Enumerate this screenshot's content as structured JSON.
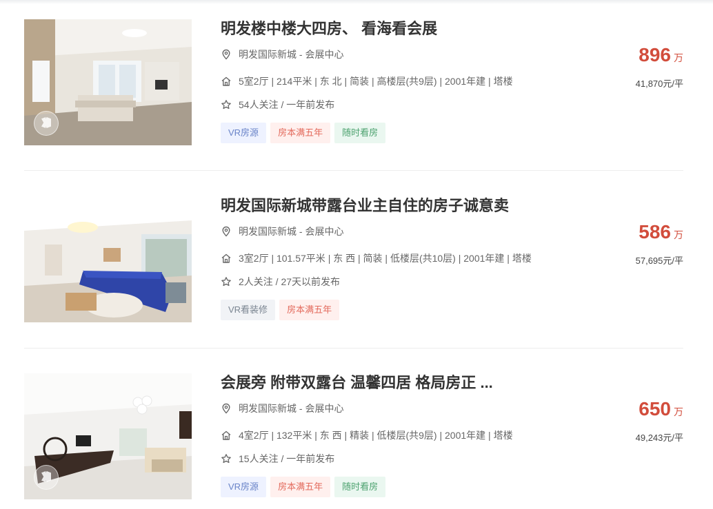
{
  "listings": [
    {
      "title": "明发楼中楼大四房、 看海看会展",
      "address": "明发国际新城 - 会展中心",
      "specs": "5室2厅 | 214平米 | 东 北 | 简装 | 高楼层(共9层) | 2001年建 | 塔楼",
      "follow": "54人关注 / 一年前发布",
      "tags": [
        "VR房源",
        "房本满五年",
        "随时看房"
      ],
      "price": "896",
      "price_unit": "万",
      "unit_price": "41,870元/平"
    },
    {
      "title": "明发国际新城带露台业主自住的房子诚意卖",
      "address": "明发国际新城 - 会展中心",
      "specs": "3室2厅 | 101.57平米 | 东 西 | 简装 | 低楼层(共10层) | 2001年建 | 塔楼",
      "follow": "2人关注 / 27天以前发布",
      "tags": [
        "VR看装修",
        "房本满五年"
      ],
      "price": "586",
      "price_unit": "万",
      "unit_price": "57,695元/平"
    },
    {
      "title": "会展旁 附带双露台 温馨四居 格局房正 ...",
      "address": "明发国际新城 - 会展中心",
      "specs": "4室2厅 | 132平米 | 东 西 | 精装 | 低楼层(共9层) | 2001年建 | 塔楼",
      "follow": "15人关注 / 一年前发布",
      "tags": [
        "VR房源",
        "房本满五年",
        "随时看房"
      ],
      "price": "650",
      "price_unit": "万",
      "unit_price": "49,243元/平"
    }
  ],
  "icons": {
    "address": "location-pin-icon",
    "specs": "house-icon",
    "follow": "star-icon",
    "photo_badge": "vr-360-icon"
  },
  "colors": {
    "price": "#d24d3c",
    "tag_vr": "#6a84c8",
    "tag_five_years": "#e36a5c",
    "tag_anytime": "#4da26f"
  }
}
